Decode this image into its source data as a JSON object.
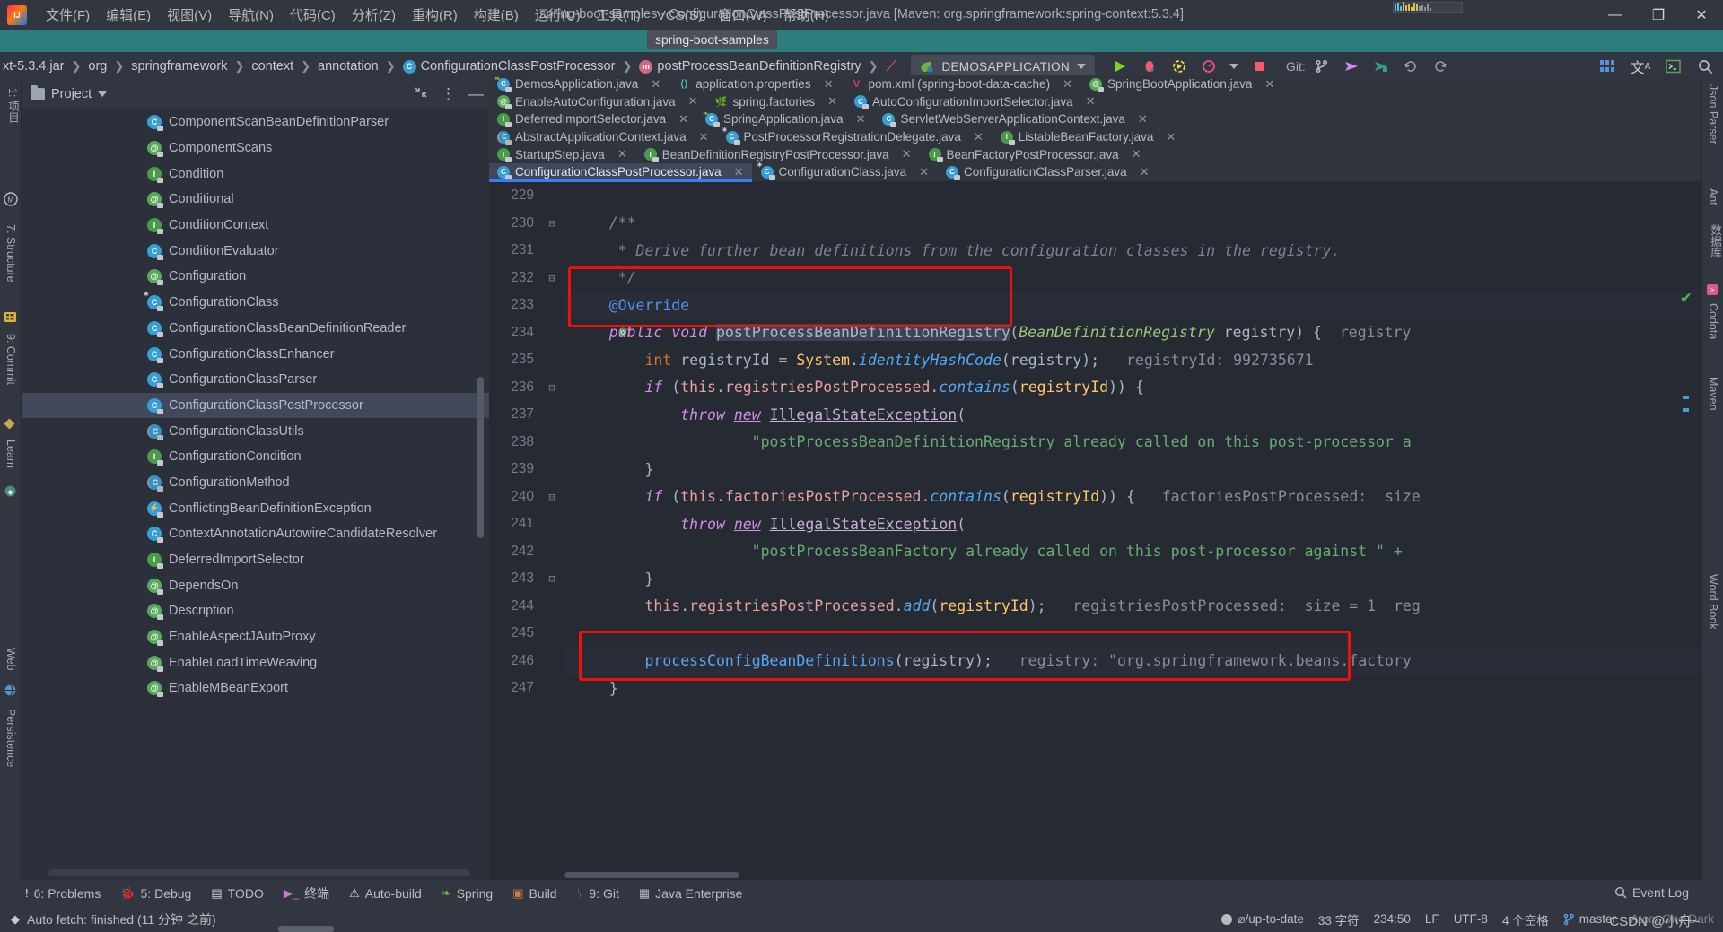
{
  "window": {
    "title": "spring-boot-samples - ConfigurationClassPostProcessor.java [Maven: org.springframework:spring-context:5.3.4]",
    "minimize": "—",
    "restore": "❐",
    "close": "✕",
    "tooltip": "spring-boot-samples"
  },
  "menu": [
    {
      "label": "文件(F)"
    },
    {
      "label": "编辑(E)"
    },
    {
      "label": "视图(V)"
    },
    {
      "label": "导航(N)"
    },
    {
      "label": "代码(C)"
    },
    {
      "label": "分析(Z)"
    },
    {
      "label": "重构(R)"
    },
    {
      "label": "构建(B)"
    },
    {
      "label": "运行(U)"
    },
    {
      "label": "工具(T)"
    },
    {
      "label": "VCS(S)"
    },
    {
      "label": "窗口(W)"
    },
    {
      "label": "帮助(H)"
    }
  ],
  "navbar": {
    "crumbs": [
      {
        "label": "xt-5.3.4.jar",
        "icon": "jar-icon"
      },
      {
        "label": "org",
        "icon": "package-icon"
      },
      {
        "label": "springframework",
        "icon": "package-icon"
      },
      {
        "label": "context",
        "icon": "package-icon"
      },
      {
        "label": "annotation",
        "icon": "package-icon"
      },
      {
        "label": "ConfigurationClassPostProcessor",
        "icon": "class-icon"
      },
      {
        "label": "postProcessBeanDefinitionRegistry",
        "icon": "method-icon"
      }
    ],
    "separator": "❯",
    "run_config": "DEMOSAPPLICATION",
    "git_label": "Git:",
    "icons": [
      "run-icon",
      "debug-icon",
      "run-coverage-icon",
      "profiler-icon",
      "stop-icon",
      "git-branch-icon",
      "git-update-icon",
      "git-commit-icon",
      "git-history-icon",
      "rollback-icon",
      "grid-icon",
      "translate-icon",
      "terminal-icon",
      "search-icon"
    ]
  },
  "rail_left": [
    {
      "label": "1: 项目",
      "icon": "project-icon"
    },
    {
      "label": "",
      "icon": "maven-circle-icon"
    },
    {
      "label": "7: Structure",
      "icon": "structure-icon"
    },
    {
      "label": "",
      "icon": "database-icon"
    },
    {
      "label": "9: Commit",
      "icon": "commit-icon"
    },
    {
      "label": "Learn",
      "icon": "learn-icon"
    },
    {
      "label": "Web",
      "icon": "web-icon"
    },
    {
      "label": "Persistence",
      "icon": "persistence-icon"
    }
  ],
  "rail_right": [
    {
      "label": "Json Parser",
      "icon": "json-icon"
    },
    {
      "label": "Ant",
      "icon": "ant-icon"
    },
    {
      "label": "数据库",
      "icon": "database-icon"
    },
    {
      "label": "Maven",
      "icon": "maven-icon"
    },
    {
      "label": "Codota",
      "icon": "codota-icon"
    },
    {
      "label": "Word Book",
      "icon": "wordbook-icon"
    }
  ],
  "project_panel": {
    "title": "Project",
    "tree": [
      {
        "label": "ComponentScanBeanDefinitionParser",
        "kind": "class",
        "selected": false
      },
      {
        "label": "ComponentScans",
        "kind": "annotation",
        "selected": false
      },
      {
        "label": "Condition",
        "kind": "interface",
        "selected": false
      },
      {
        "label": "Conditional",
        "kind": "annotation",
        "selected": false
      },
      {
        "label": "ConditionContext",
        "kind": "interface",
        "selected": false
      },
      {
        "label": "ConditionEvaluator",
        "kind": "class",
        "selected": false
      },
      {
        "label": "Configuration",
        "kind": "annotation",
        "selected": false
      },
      {
        "label": "ConfigurationClass",
        "kind": "class-final",
        "selected": false
      },
      {
        "label": "ConfigurationClassBeanDefinitionReader",
        "kind": "class",
        "selected": false
      },
      {
        "label": "ConfigurationClassEnhancer",
        "kind": "class",
        "selected": false
      },
      {
        "label": "ConfigurationClassParser",
        "kind": "class",
        "selected": false
      },
      {
        "label": "ConfigurationClassPostProcessor",
        "kind": "class",
        "selected": true
      },
      {
        "label": "ConfigurationClassUtils",
        "kind": "class-abstract",
        "selected": false
      },
      {
        "label": "ConfigurationCondition",
        "kind": "interface",
        "selected": false
      },
      {
        "label": "ConfigurationMethod",
        "kind": "class-abstract",
        "selected": false
      },
      {
        "label": "ConflictingBeanDefinitionException",
        "kind": "exception",
        "selected": false
      },
      {
        "label": "ContextAnnotationAutowireCandidateResolver",
        "kind": "class",
        "selected": false
      },
      {
        "label": "DeferredImportSelector",
        "kind": "interface",
        "selected": false
      },
      {
        "label": "DependsOn",
        "kind": "annotation",
        "selected": false
      },
      {
        "label": "Description",
        "kind": "annotation",
        "selected": false
      },
      {
        "label": "EnableAspectJAutoProxy",
        "kind": "annotation",
        "selected": false
      },
      {
        "label": "EnableLoadTimeWeaving",
        "kind": "annotation",
        "selected": false
      },
      {
        "label": "EnableMBeanExport",
        "kind": "annotation",
        "selected": false
      }
    ]
  },
  "editor": {
    "tab_rows": [
      [
        {
          "label": "DemosApplication.java",
          "kind": "class-spring",
          "close": "✕",
          "active": false
        },
        {
          "label": "application.properties",
          "kind": "properties",
          "close": "✕",
          "active": false
        },
        {
          "label": "pom.xml (spring-boot-data-cache)",
          "kind": "maven",
          "close": "✕",
          "active": false
        },
        {
          "label": "SpringBootApplication.java",
          "kind": "annotation",
          "close": "✕",
          "active": false
        }
      ],
      [
        {
          "label": "EnableAutoConfiguration.java",
          "kind": "annotation",
          "close": "✕",
          "active": false
        },
        {
          "label": "spring.factories",
          "kind": "spring",
          "close": "✕",
          "active": false
        },
        {
          "label": "AutoConfigurationImportSelector.java",
          "kind": "class",
          "close": "✕",
          "active": false
        }
      ],
      [
        {
          "label": "DeferredImportSelector.java",
          "kind": "interface",
          "close": "✕",
          "active": false
        },
        {
          "label": "SpringApplication.java",
          "kind": "class-spring",
          "close": "✕",
          "active": false
        },
        {
          "label": "ServletWebServerApplicationContext.java",
          "kind": "class",
          "close": "✕",
          "active": false
        }
      ],
      [
        {
          "label": "AbstractApplicationContext.java",
          "kind": "class-abstract",
          "close": "✕",
          "active": false
        },
        {
          "label": "PostProcessorRegistrationDelegate.java",
          "kind": "class-final",
          "close": "✕",
          "active": false
        },
        {
          "label": "ListableBeanFactory.java",
          "kind": "interface",
          "close": "✕",
          "active": false
        }
      ],
      [
        {
          "label": "StartupStep.java",
          "kind": "interface",
          "close": "✕",
          "active": false
        },
        {
          "label": "BeanDefinitionRegistryPostProcessor.java",
          "kind": "interface",
          "close": "✕",
          "active": false
        },
        {
          "label": "BeanFactoryPostProcessor.java",
          "kind": "interface",
          "close": "✕",
          "active": false
        }
      ],
      [
        {
          "label": "ConfigurationClassPostProcessor.java",
          "kind": "class",
          "close": "✕",
          "active": true
        },
        {
          "label": "ConfigurationClass.java",
          "kind": "class-final",
          "close": "✕",
          "active": false
        },
        {
          "label": "ConfigurationClassParser.java",
          "kind": "class",
          "close": "✕",
          "active": false
        }
      ]
    ],
    "line_numbers": [
      229,
      230,
      231,
      232,
      233,
      234,
      235,
      236,
      237,
      238,
      239,
      240,
      241,
      242,
      243,
      244,
      245,
      246,
      247
    ],
    "code_lines": [
      {
        "no": 229,
        "text": ""
      },
      {
        "no": 230,
        "text": "    /**"
      },
      {
        "no": 231,
        "text": "     * Derive further bean definitions from the configuration classes in the registry."
      },
      {
        "no": 232,
        "text": "     */"
      },
      {
        "no": 233,
        "text": "    @Override"
      },
      {
        "no": 234,
        "text": "    public void postProcessBeanDefinitionRegistry(BeanDefinitionRegistry registry) {  registry"
      },
      {
        "no": 235,
        "text": "        int registryId = System.identityHashCode(registry);   registryId: 992735671"
      },
      {
        "no": 236,
        "text": "        if (this.registriesPostProcessed.contains(registryId)) {"
      },
      {
        "no": 237,
        "text": "            throw new IllegalStateException("
      },
      {
        "no": 238,
        "text": "                    \"postProcessBeanDefinitionRegistry already called on this post-processor a"
      },
      {
        "no": 239,
        "text": "        }"
      },
      {
        "no": 240,
        "text": "        if (this.factoriesPostProcessed.contains(registryId)) {   factoriesPostProcessed:  size"
      },
      {
        "no": 241,
        "text": "            throw new IllegalStateException("
      },
      {
        "no": 242,
        "text": "                    \"postProcessBeanFactory already called on this post-processor against \" +"
      },
      {
        "no": 243,
        "text": "        }"
      },
      {
        "no": 244,
        "text": "        this.registriesPostProcessed.add(registryId);   registriesPostProcessed:  size = 1  reg"
      },
      {
        "no": 245,
        "text": ""
      },
      {
        "no": 246,
        "text": "        processConfigBeanDefinitions(registry);   registry: \"org.springframework.beans.factory"
      },
      {
        "no": 247,
        "text": "    }"
      }
    ],
    "inlay_hints": {
      "line235": "registryId: 992735671",
      "line240": "factoriesPostProcessed:  size",
      "line244": "registriesPostProcessed:  size = 1  reg",
      "line246": "registry: \"org.springframework.beans.factory"
    }
  },
  "tool_window_bar": [
    {
      "label": "6: Problems",
      "icon": "problems-icon"
    },
    {
      "label": "5: Debug",
      "icon": "debug-icon"
    },
    {
      "label": "TODO",
      "icon": "todo-icon"
    },
    {
      "label": "终端",
      "icon": "terminal-icon"
    },
    {
      "label": "Auto-build",
      "icon": "warning-icon"
    },
    {
      "label": "Spring",
      "icon": "spring-leaf-icon"
    },
    {
      "label": "Build",
      "icon": "build-icon"
    },
    {
      "label": "9: Git",
      "icon": "git-icon"
    },
    {
      "label": "Java Enterprise",
      "icon": "java-enterprise-icon"
    }
  ],
  "statusbar": {
    "message": "Auto fetch: finished (11 分钟 之前)",
    "vcs_status": "⌀/up-to-date",
    "char_count": "33 字符",
    "caret_pos": "234:50",
    "line_sep": "LF",
    "encoding": "UTF-8",
    "indent": "4 个空格",
    "branch": "master",
    "theme": "Atom One Dark",
    "event_log": "Event Log",
    "watermark": "CSDN @小舟~"
  }
}
